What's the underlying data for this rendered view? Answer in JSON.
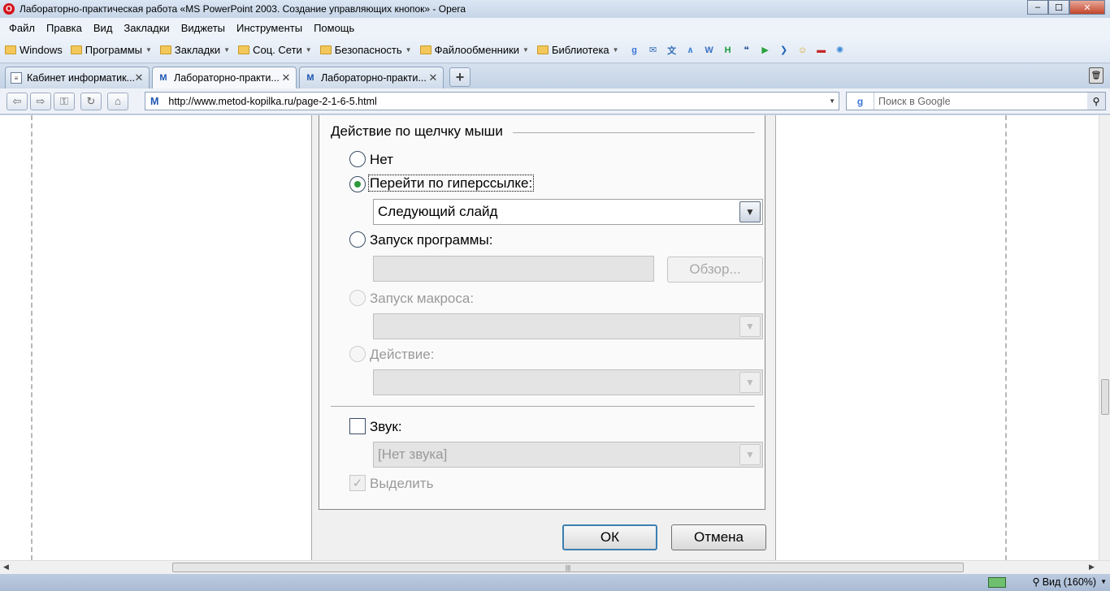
{
  "window": {
    "title": "Лабораторно-практическая работа «MS PowerPoint 2003. Создание управляющих кнопок» - Opera",
    "min": "–",
    "max": "☐",
    "close": "✕"
  },
  "menu": [
    "Файл",
    "Правка",
    "Вид",
    "Закладки",
    "Виджеты",
    "Инструменты",
    "Помощь"
  ],
  "bookmarks": {
    "folders": [
      "Windows",
      "Программы",
      "Закладки",
      "Соц. Сети",
      "Безопасность",
      "Файлообменники",
      "Библиотека"
    ],
    "arrow": "▼",
    "icons": [
      {
        "name": "google-icon",
        "glyph": "g",
        "color": "#3a74d8"
      },
      {
        "name": "mail-icon",
        "glyph": "✉",
        "color": "#2f6bb5"
      },
      {
        "name": "translate-icon",
        "glyph": "文",
        "color": "#2f6bb5"
      },
      {
        "name": "wiki-icon",
        "glyph": "∧",
        "color": "#4c8bd6"
      },
      {
        "name": "word-icon",
        "glyph": "W",
        "color": "#3a6fc4"
      },
      {
        "name": "h-icon",
        "glyph": "H",
        "color": "#1b9b3b"
      },
      {
        "name": "quote-icon",
        "glyph": "❝",
        "color": "#1e4f8a"
      },
      {
        "name": "play-icon",
        "glyph": "▶",
        "color": "#29a23c"
      },
      {
        "name": "arrow-right-icon",
        "glyph": "❯",
        "color": "#1f63b8"
      },
      {
        "name": "smiley-icon",
        "glyph": "☺",
        "color": "#e0a31a"
      },
      {
        "name": "flag-icon",
        "glyph": "▬",
        "color": "#c62828"
      },
      {
        "name": "gear-flower-icon",
        "glyph": "✺",
        "color": "#3c8ad8"
      }
    ]
  },
  "tabs": [
    {
      "label": "Кабинет информатик...",
      "icon": "document-icon",
      "glyph": "≡",
      "active": false
    },
    {
      "label": "Лабораторно-практи...",
      "icon": "m-site-icon",
      "glyph": "M",
      "active": true
    },
    {
      "label": "Лабораторно-практи...",
      "icon": "m-site-icon",
      "glyph": "M",
      "active": false
    }
  ],
  "tab_close": "✕",
  "new_tab": "+",
  "address": {
    "site_glyph": "M",
    "url": "http://www.metod-kopilka.ru/page-2-1-6-5.html",
    "dropdown": "▼",
    "search_engine": "g",
    "search_placeholder": "Поиск в Google",
    "search_glyph": "⚲"
  },
  "nav": {
    "back": "⇦",
    "forward": "⇨",
    "key": "⚿",
    "reload": "↻",
    "home": "⌂"
  },
  "dialog": {
    "group_title": "Действие по щелчку мыши",
    "option_none": "Нет",
    "option_hyperlink": "Перейти по гиперссылке:",
    "hyperlink_value": "Следующий слайд",
    "option_program": "Запуск программы:",
    "browse_button": "Обзор...",
    "option_macro": "Запуск макроса:",
    "option_action": "Действие:",
    "sound_label": "Звук:",
    "sound_value": "[Нет звука]",
    "highlight_label": "Выделить",
    "ok_button": "ОК",
    "cancel_button": "Отмена",
    "combo_arrow": "▼",
    "check_glyph": "✓"
  },
  "hscroll": {
    "left": "◀",
    "grip": "|||",
    "right": "▶"
  },
  "status": {
    "zoom_label": "Вид (160%)",
    "zoom_arrow": "▼",
    "zoom_glyph": "⚲"
  }
}
